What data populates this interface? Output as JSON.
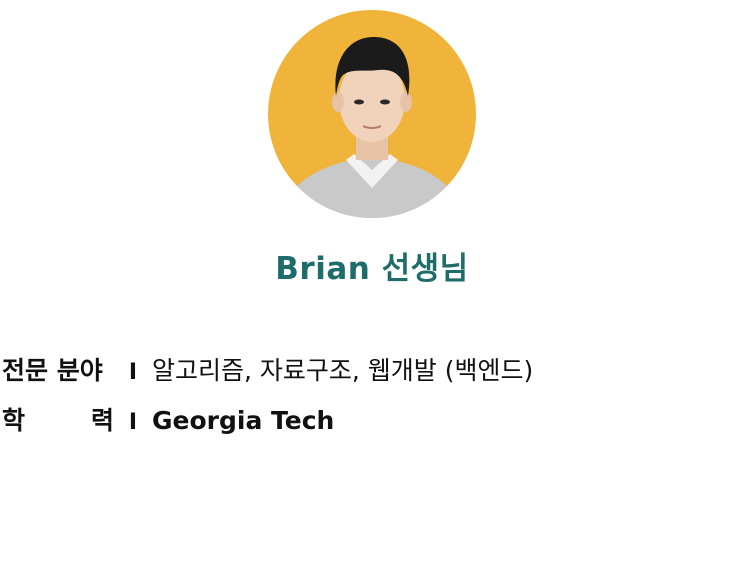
{
  "teacher": {
    "name": "Brian 선생님",
    "photo_background": "#f0b43a",
    "name_color": "#1f6d6b"
  },
  "info": {
    "expertise": {
      "label": "전문 분야",
      "separator": "I",
      "value": "알고리즘, 자료구조, 웹개발 (백엔드)"
    },
    "education": {
      "label_left": "학",
      "label_right": "력",
      "separator": "I",
      "value": "Georgia Tech"
    }
  }
}
